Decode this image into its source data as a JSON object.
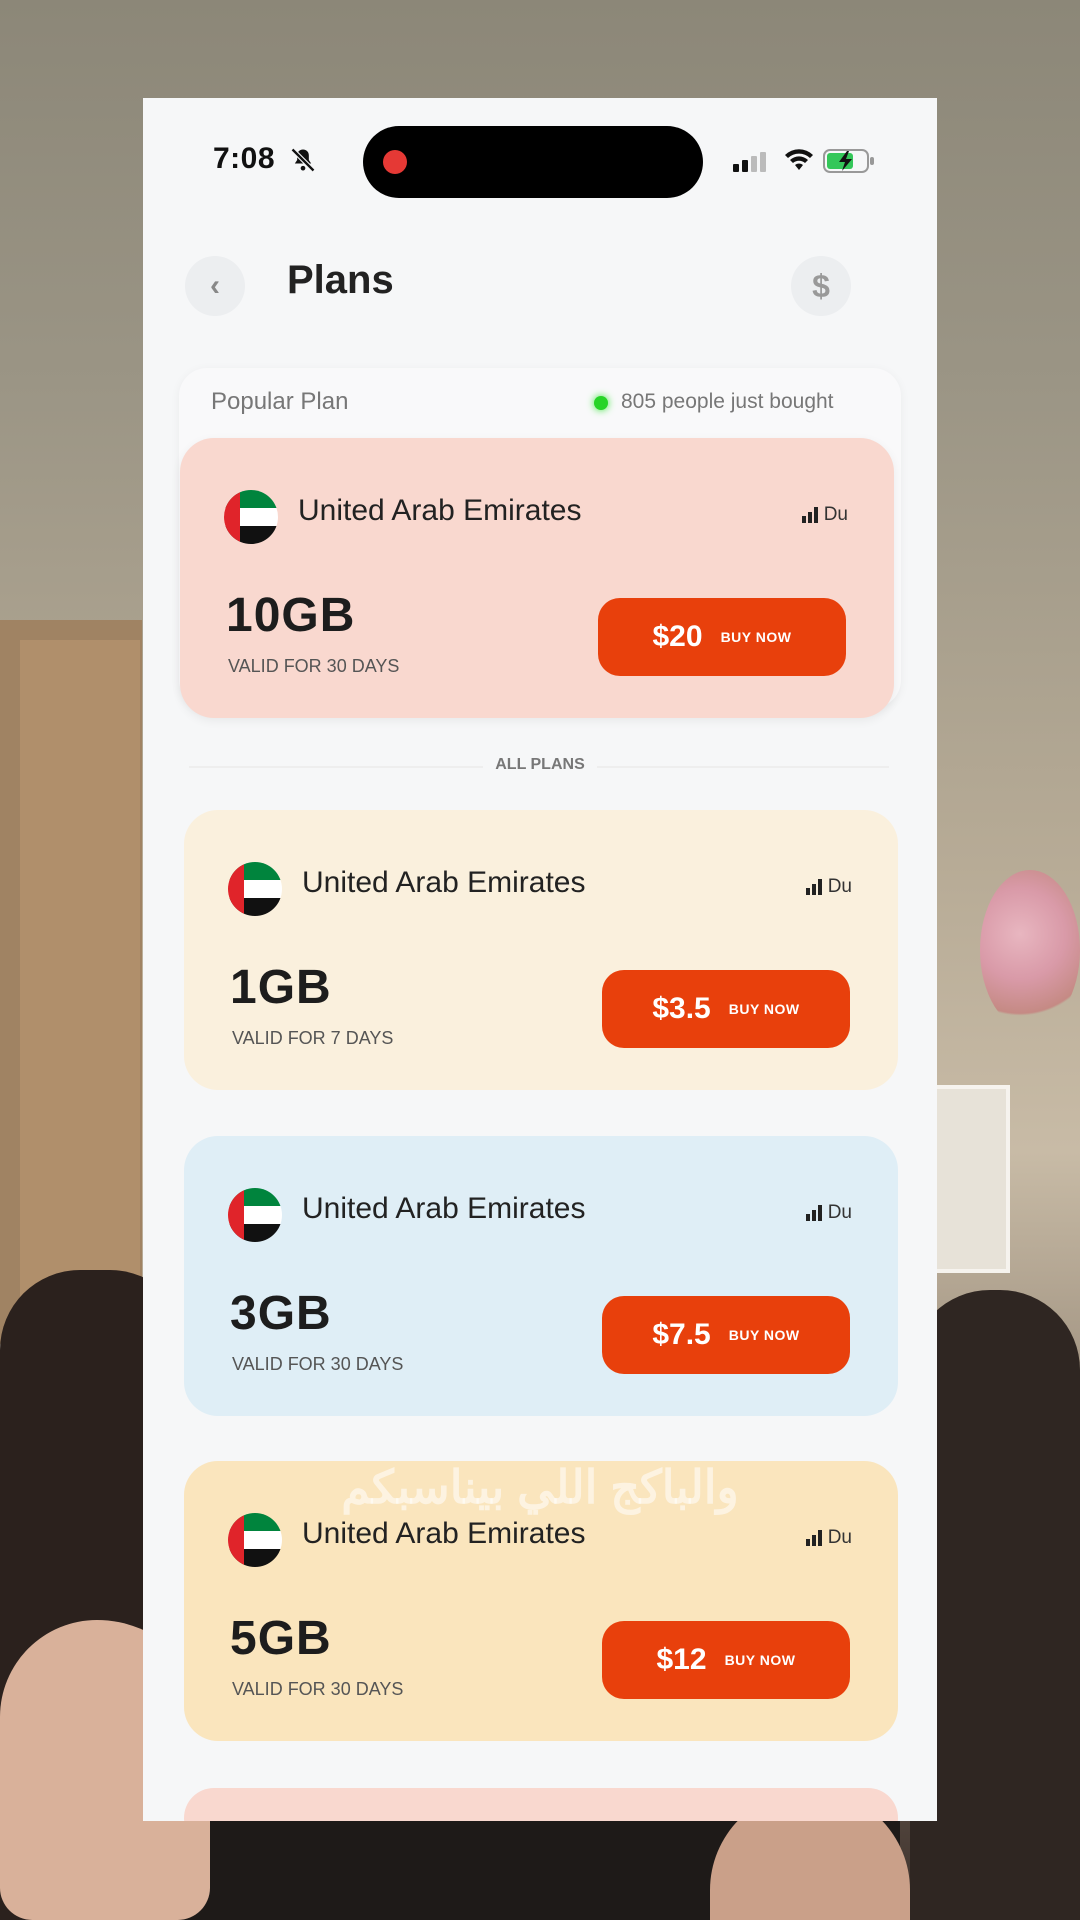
{
  "status_bar": {
    "time": "7:08"
  },
  "header": {
    "title": "Plans"
  },
  "popular": {
    "label": "Popular Plan",
    "bought_text": "805 people just bought"
  },
  "divider_label": "ALL PLANS",
  "plans": [
    {
      "country": "United Arab Emirates",
      "carrier": "Du",
      "data": "10GB",
      "validity": "VALID FOR 30 DAYS",
      "price": "$20",
      "buy_label": "BUY NOW"
    },
    {
      "country": "United Arab Emirates",
      "carrier": "Du",
      "data": "1GB",
      "validity": "VALID FOR 7 DAYS",
      "price": "$3.5",
      "buy_label": "BUY NOW"
    },
    {
      "country": "United Arab Emirates",
      "carrier": "Du",
      "data": "3GB",
      "validity": "VALID FOR 30 DAYS",
      "price": "$7.5",
      "buy_label": "BUY NOW"
    },
    {
      "country": "United Arab Emirates",
      "carrier": "Du",
      "data": "5GB",
      "validity": "VALID FOR 30 DAYS",
      "price": "$12",
      "buy_label": "BUY NOW"
    }
  ],
  "subtitle": "والباكج اللي بيناسبكم",
  "colors": {
    "buy_button": "#e8400c",
    "popular_card": "#f9d8cf",
    "card_1gb": "#faf0dd",
    "card_3gb": "#dfeef6",
    "card_5gb": "#fae5bd"
  }
}
